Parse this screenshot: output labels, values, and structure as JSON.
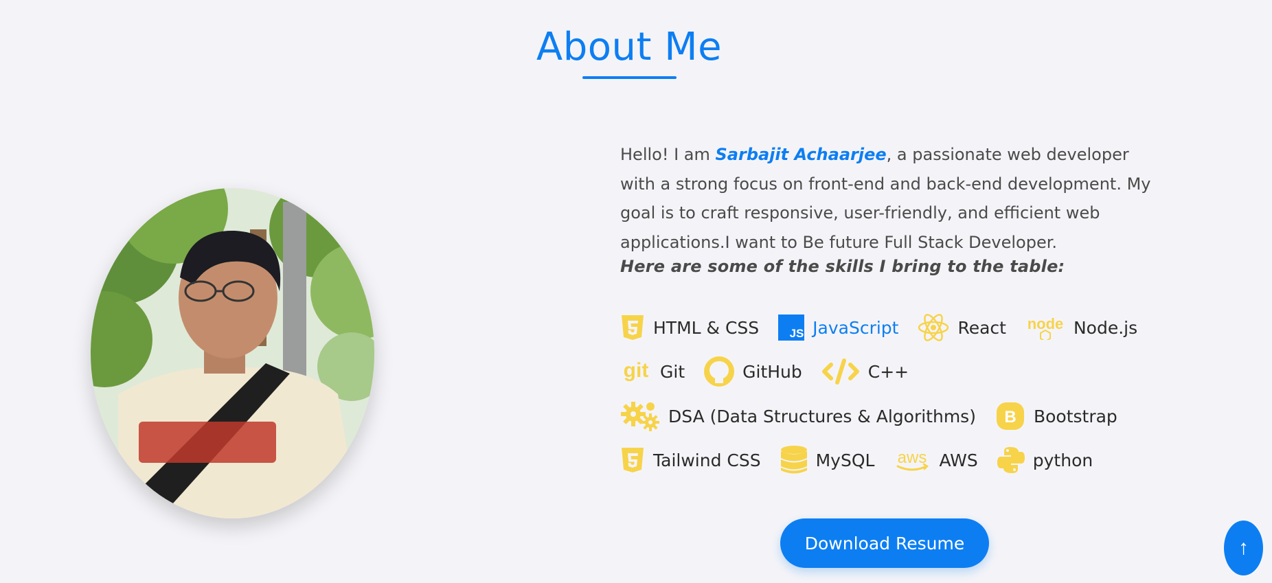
{
  "section": {
    "title": "About Me"
  },
  "about": {
    "intro_before": "Hello! I am ",
    "name": "Sarbajit Achaarjee",
    "intro_after": ", a passionate web developer with a strong focus on front-end and back-end development. My goal is to craft responsive, user-friendly, and efficient web applications.I want to Be future Full Stack Developer.",
    "skills_heading": "Here are some of the skills I bring to the table:"
  },
  "skills": [
    {
      "label": "HTML & CSS",
      "icon": "html5-icon"
    },
    {
      "label": "JavaScript",
      "icon": "javascript-icon",
      "active": true
    },
    {
      "label": "React",
      "icon": "react-icon"
    },
    {
      "label": "Node.js",
      "icon": "nodejs-icon"
    },
    {
      "label": "Git",
      "icon": "git-icon"
    },
    {
      "label": "GitHub",
      "icon": "github-icon"
    },
    {
      "label": "C++",
      "icon": "code-icon"
    },
    {
      "label": "DSA (Data Structures & Algorithms)",
      "icon": "gears-icon"
    },
    {
      "label": "Bootstrap",
      "icon": "bootstrap-icon"
    },
    {
      "label": "Tailwind CSS",
      "icon": "css3-icon"
    },
    {
      "label": "MySQL",
      "icon": "database-icon"
    },
    {
      "label": "AWS",
      "icon": "aws-icon"
    },
    {
      "label": "python",
      "icon": "python-icon"
    }
  ],
  "buttons": {
    "download_resume": "Download Resume",
    "scroll_top": "↑"
  },
  "colors": {
    "accent": "#0d7ef2",
    "icon_yellow": "#f7d34a",
    "background": "#f4f4f8",
    "text": "#4a4a4a"
  }
}
